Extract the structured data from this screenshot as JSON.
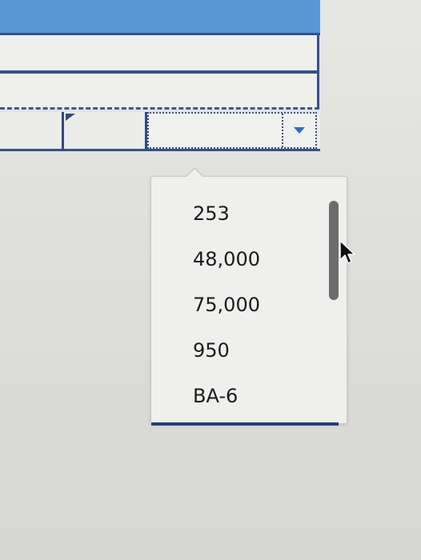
{
  "dropdown": {
    "options": [
      {
        "label": "253"
      },
      {
        "label": "48,000"
      },
      {
        "label": "75,000"
      },
      {
        "label": "950"
      },
      {
        "label": "BA-6"
      }
    ],
    "open_icon": "chevron-down-icon",
    "scrollbar_position": 0
  },
  "colors": {
    "header_band": "#5b96d4",
    "grid_lines": "#34518a",
    "chevron": "#2c6fb9",
    "scroll_thumb": "#6c6c6c"
  },
  "cursor_icon": "arrow-cursor-icon"
}
